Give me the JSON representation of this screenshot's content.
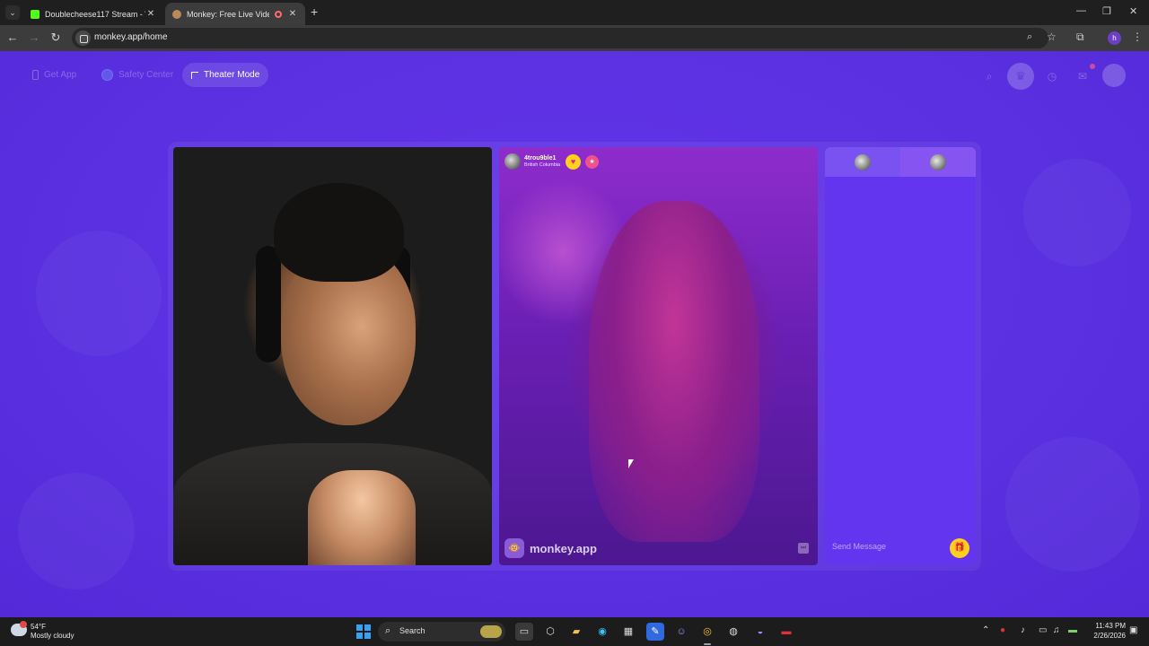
{
  "browser": {
    "tabs": [
      {
        "title": "Doublecheese117 Stream - Wa",
        "close": "✕"
      },
      {
        "title": "Monkey: Free Live Video Ch",
        "close": "✕"
      }
    ],
    "new_tab": "+",
    "window_controls": {
      "minimize": "—",
      "restore": "❐",
      "close": "✕"
    },
    "nav": {
      "back": "←",
      "forward": "→",
      "reload": "↻"
    },
    "url": "monkey.app/home",
    "profile_initial": "h"
  },
  "page": {
    "top_buttons": [
      {
        "label": "Get App",
        "icon": "phone-icon"
      },
      {
        "label": "Safety Center",
        "icon": "shield-icon"
      },
      {
        "label": "Theater Mode",
        "icon": "expand-icon"
      }
    ],
    "top_right_icons": [
      "search-icon",
      "crown-icon",
      "history-icon",
      "chat-icon",
      "avatar"
    ],
    "peer": {
      "name": "4trou9ble1",
      "location": "British Columbia",
      "heart": "♥",
      "badge": "★"
    },
    "watermark": {
      "logo": "🐵",
      "text": "monkey.app"
    },
    "flag_icon": "⏭",
    "chat": {
      "placeholder": "Send Message",
      "gift_icon": "🎁"
    }
  },
  "taskbar": {
    "weather": {
      "temp": "54°F",
      "condition": "Mostly cloudy"
    },
    "search_label": "Search",
    "clock": {
      "time": "11:43 PM",
      "date": "2/26/2026"
    }
  },
  "colors": {
    "page_bg": "#5b2fe0",
    "chat_panel": "#6435ee",
    "gift": "#ffcf1f",
    "heart_badge": "#ffd21f"
  }
}
